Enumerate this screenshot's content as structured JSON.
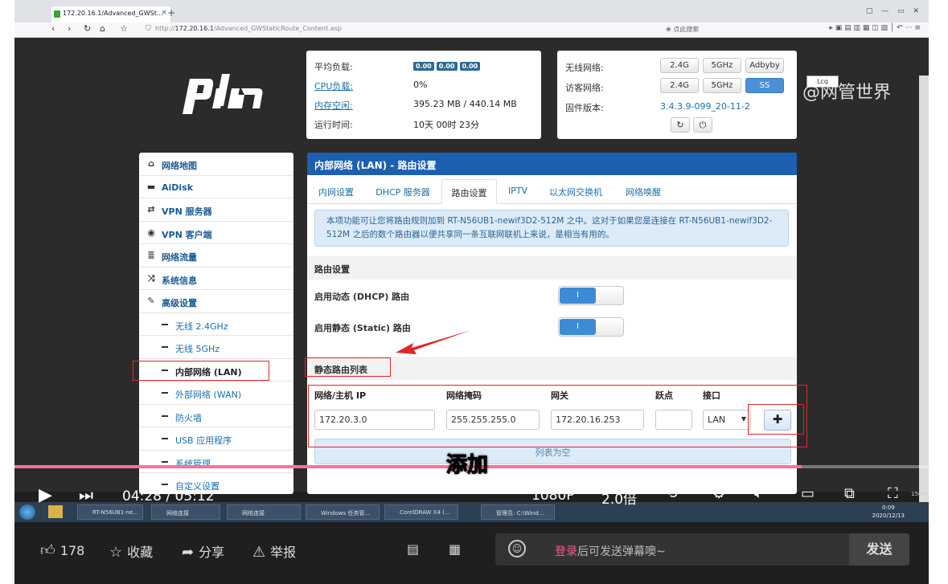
{
  "browser": {
    "tab_title": "172.20.16.1/Advanced_GWSt...",
    "url_host": "172.20.16.1",
    "url_path": "/Advanced_GWStaticRoute_Content.asp",
    "url_scheme": "http://",
    "search_placeholder": "点此搜索",
    "lang_badge": "Lcq"
  },
  "watermark": "@网管世界",
  "system": {
    "load_label": "平均负载:",
    "load_values": [
      "0.00",
      "0.00",
      "0.00"
    ],
    "cpu_label": "CPU负载:",
    "cpu_value": "0%",
    "mem_label": "内存空闲:",
    "mem_value": "395.23 MB / 440.14 MB",
    "uptime_label": "运行时间:",
    "uptime_value": "10天 00时 23分"
  },
  "wireless": {
    "wifi_label": "无线网络:",
    "wifi_buttons": [
      "2.4G",
      "5GHz",
      "Adbyby"
    ],
    "guest_label": "访客网络:",
    "guest_buttons": [
      "2.4G",
      "5GHz",
      "SS"
    ],
    "fw_label": "固件版本:",
    "fw_value": "3.4.3.9-099_20-11-2"
  },
  "sidebar": {
    "items": [
      {
        "label": "网络地图",
        "icon": "home-icon"
      },
      {
        "label": "AiDisk",
        "icon": "disk-icon"
      },
      {
        "label": "VPN 服务器",
        "icon": "vpn-server-icon"
      },
      {
        "label": "VPN 客户端",
        "icon": "globe-icon"
      },
      {
        "label": "网络流量",
        "icon": "list-icon"
      },
      {
        "label": "系统信息",
        "icon": "shuffle-icon"
      },
      {
        "label": "高级设置",
        "icon": "wrench-icon"
      }
    ],
    "sub_items": [
      "无线 2.4GHz",
      "无线 5GHz",
      "内部网络 (LAN)",
      "外部网络 (WAN)",
      "防火墙",
      "USB 应用程序",
      "系统管理",
      "自定义设置"
    ]
  },
  "main": {
    "title": "内部网络 (LAN) - 路由设置",
    "tabs": [
      "内网设置",
      "DHCP 服务器",
      "路由设置",
      "IPTV",
      "以太网交换机",
      "网络唤醒"
    ],
    "info": "本项功能可让您将路由规则加到 RT-N56UB1-newif3D2-512M 之中。这对于如果您是连接在 RT-N56UB1-newif3D2-512M 之后的数个路由器以便共享同一条互联网联机上来说，是相当有用的。",
    "section_routing": "路由设置",
    "opt_dhcp": "启用动态 (DHCP) 路由",
    "opt_static": "启用静态 (Static) 路由",
    "toggle_on": "I",
    "section_static": "静态路由列表",
    "columns": [
      "网络/主机 IP",
      "网络掩码",
      "网关",
      "跃点",
      "接口"
    ],
    "inputs": {
      "ip": "172.20.3.0",
      "mask": "255.255.255.0",
      "gateway": "172.20.16.253",
      "metric": "",
      "iface": "LAN"
    },
    "empty": "列表为空"
  },
  "taskbar": {
    "items": [
      "RT-N56UB1-ne...",
      "网络连接",
      "网络连接",
      "Windows 任务管...",
      "CorelDRAW X4 (...",
      "管理员: C:\\Wind..."
    ],
    "time": "0:09",
    "date": "2020/12/13",
    "zoom": "150%"
  },
  "player": {
    "subtitle": "添加",
    "time_current": "04:28",
    "time_total": "05:12",
    "time_sep": "/",
    "progress": 0.861,
    "quality": "1080P",
    "speed": "2.0倍"
  },
  "actions": {
    "like": "178",
    "fav": "收藏",
    "share": "分享",
    "report": "举报"
  },
  "danmaku": {
    "login": "登录",
    "hint": "后可发送弹幕噢~",
    "send": "发送"
  }
}
